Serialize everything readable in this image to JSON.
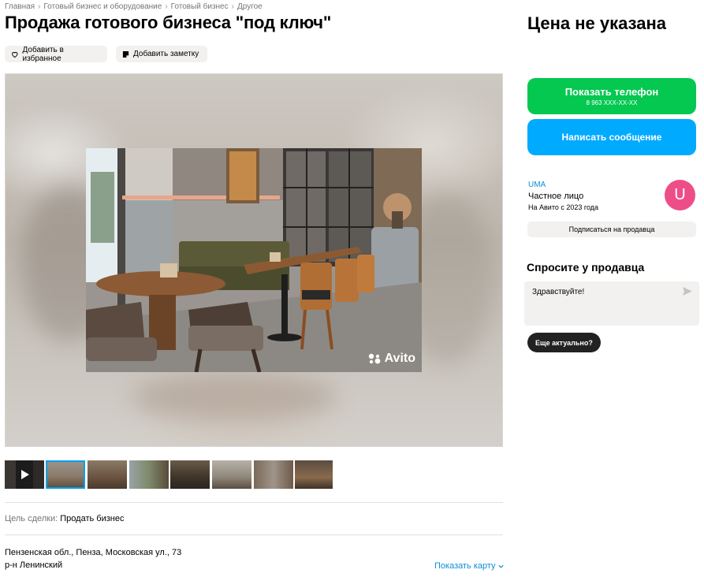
{
  "breadcrumbs": [
    "Главная",
    "Готовый бизнес и оборудование",
    "Готовый бизнес",
    "Другое"
  ],
  "breadcrumb_separator": "›",
  "title": "Продажа готового бизнеса \"под ключ\"",
  "actions": {
    "favorite_label": "Добавить в избранное",
    "note_label": "Добавить заметку"
  },
  "gallery": {
    "watermark": "Avito",
    "thumbnail_count": 8,
    "active_thumbnail_index": 1,
    "first_thumbnail_is_video": true
  },
  "details": {
    "deal_goal_label": "Цель сделки:",
    "deal_goal_value": "Продать бизнес"
  },
  "address": {
    "line1": "Пензенская обл., Пенза, Московская ул., 73",
    "line2": "р-н Ленинский",
    "map_link": "Показать карту"
  },
  "sidebar": {
    "price": "Цена не указана",
    "phone_button_label": "Показать телефон",
    "phone_masked": "8 963 XXX-XX-XX",
    "message_button_label": "Написать сообщение",
    "seller": {
      "name": "UMA",
      "type": "Частное лицо",
      "since": "На Авито с 2023 года",
      "avatar_letter": "U"
    },
    "subscribe_label": "Подписаться на продавца",
    "ask": {
      "title": "Спросите у продавца",
      "message_value": "Здравствуйте!",
      "quick_reply": "Еще актуально?"
    }
  },
  "colors": {
    "phone_button": "#04c850",
    "message_button": "#00aaff",
    "link": "#0a8fd6",
    "avatar": "#ee4e88"
  }
}
